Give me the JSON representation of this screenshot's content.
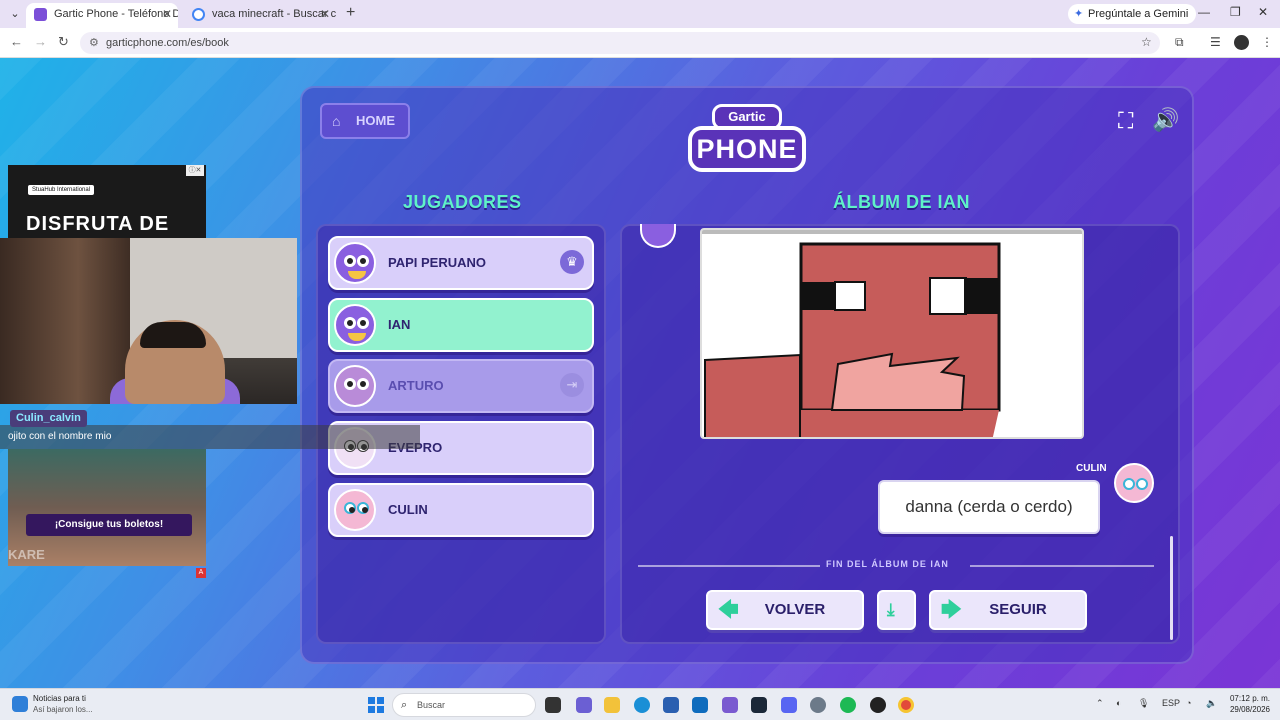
{
  "browser": {
    "tabs": [
      {
        "title": "Gartic Phone - Teléfono Descon",
        "active": true
      },
      {
        "title": "vaca minecraft - Buscar con Go",
        "active": false
      }
    ],
    "gemini_label": "Pregúntale a Gemini",
    "url": "garticphone.com/es/book"
  },
  "game": {
    "home_label": "HOME",
    "logo_top": "Gartic",
    "logo_main": "PHONE",
    "players_title": "JUGADORES",
    "album_title": "ÁLBUM DE IAN",
    "players": [
      {
        "name": "PAPI PERUANO",
        "status": "host",
        "badge_icon": "crown-icon"
      },
      {
        "name": "IAN",
        "status": "current"
      },
      {
        "name": "ARTURO",
        "status": "left",
        "badge_icon": "exit-icon"
      },
      {
        "name": "EVEPRO",
        "status": "normal"
      },
      {
        "name": "CULIN",
        "status": "normal"
      }
    ],
    "answer_author": "CULIN",
    "answer_text": "danna (cerda o cerdo)",
    "end_label": "FIN DEL ÁLBUM DE IAN",
    "back_label": "VOLVER",
    "next_label": "SEGUIR"
  },
  "overlay": {
    "ad_brand": "StuaHub International",
    "ad_headline": "DISFRUTA DE",
    "chat_user": "Culin_calvin",
    "chat_message": "ojito con el nombre mio",
    "concert_cta": "¡Consigue tus boletos!",
    "concert_brand": "KARE"
  },
  "taskbar": {
    "news_title": "Noticias para ti",
    "news_sub": "Así bajaron los...",
    "search_placeholder": "Buscar",
    "lang": "ESP",
    "time": "07:12 p. m.",
    "date": "29/08/2026"
  },
  "colors": {
    "accent_title": "#5ff2c8",
    "current_player": "#92f2cf",
    "button_icon": "#2ecf9b"
  }
}
